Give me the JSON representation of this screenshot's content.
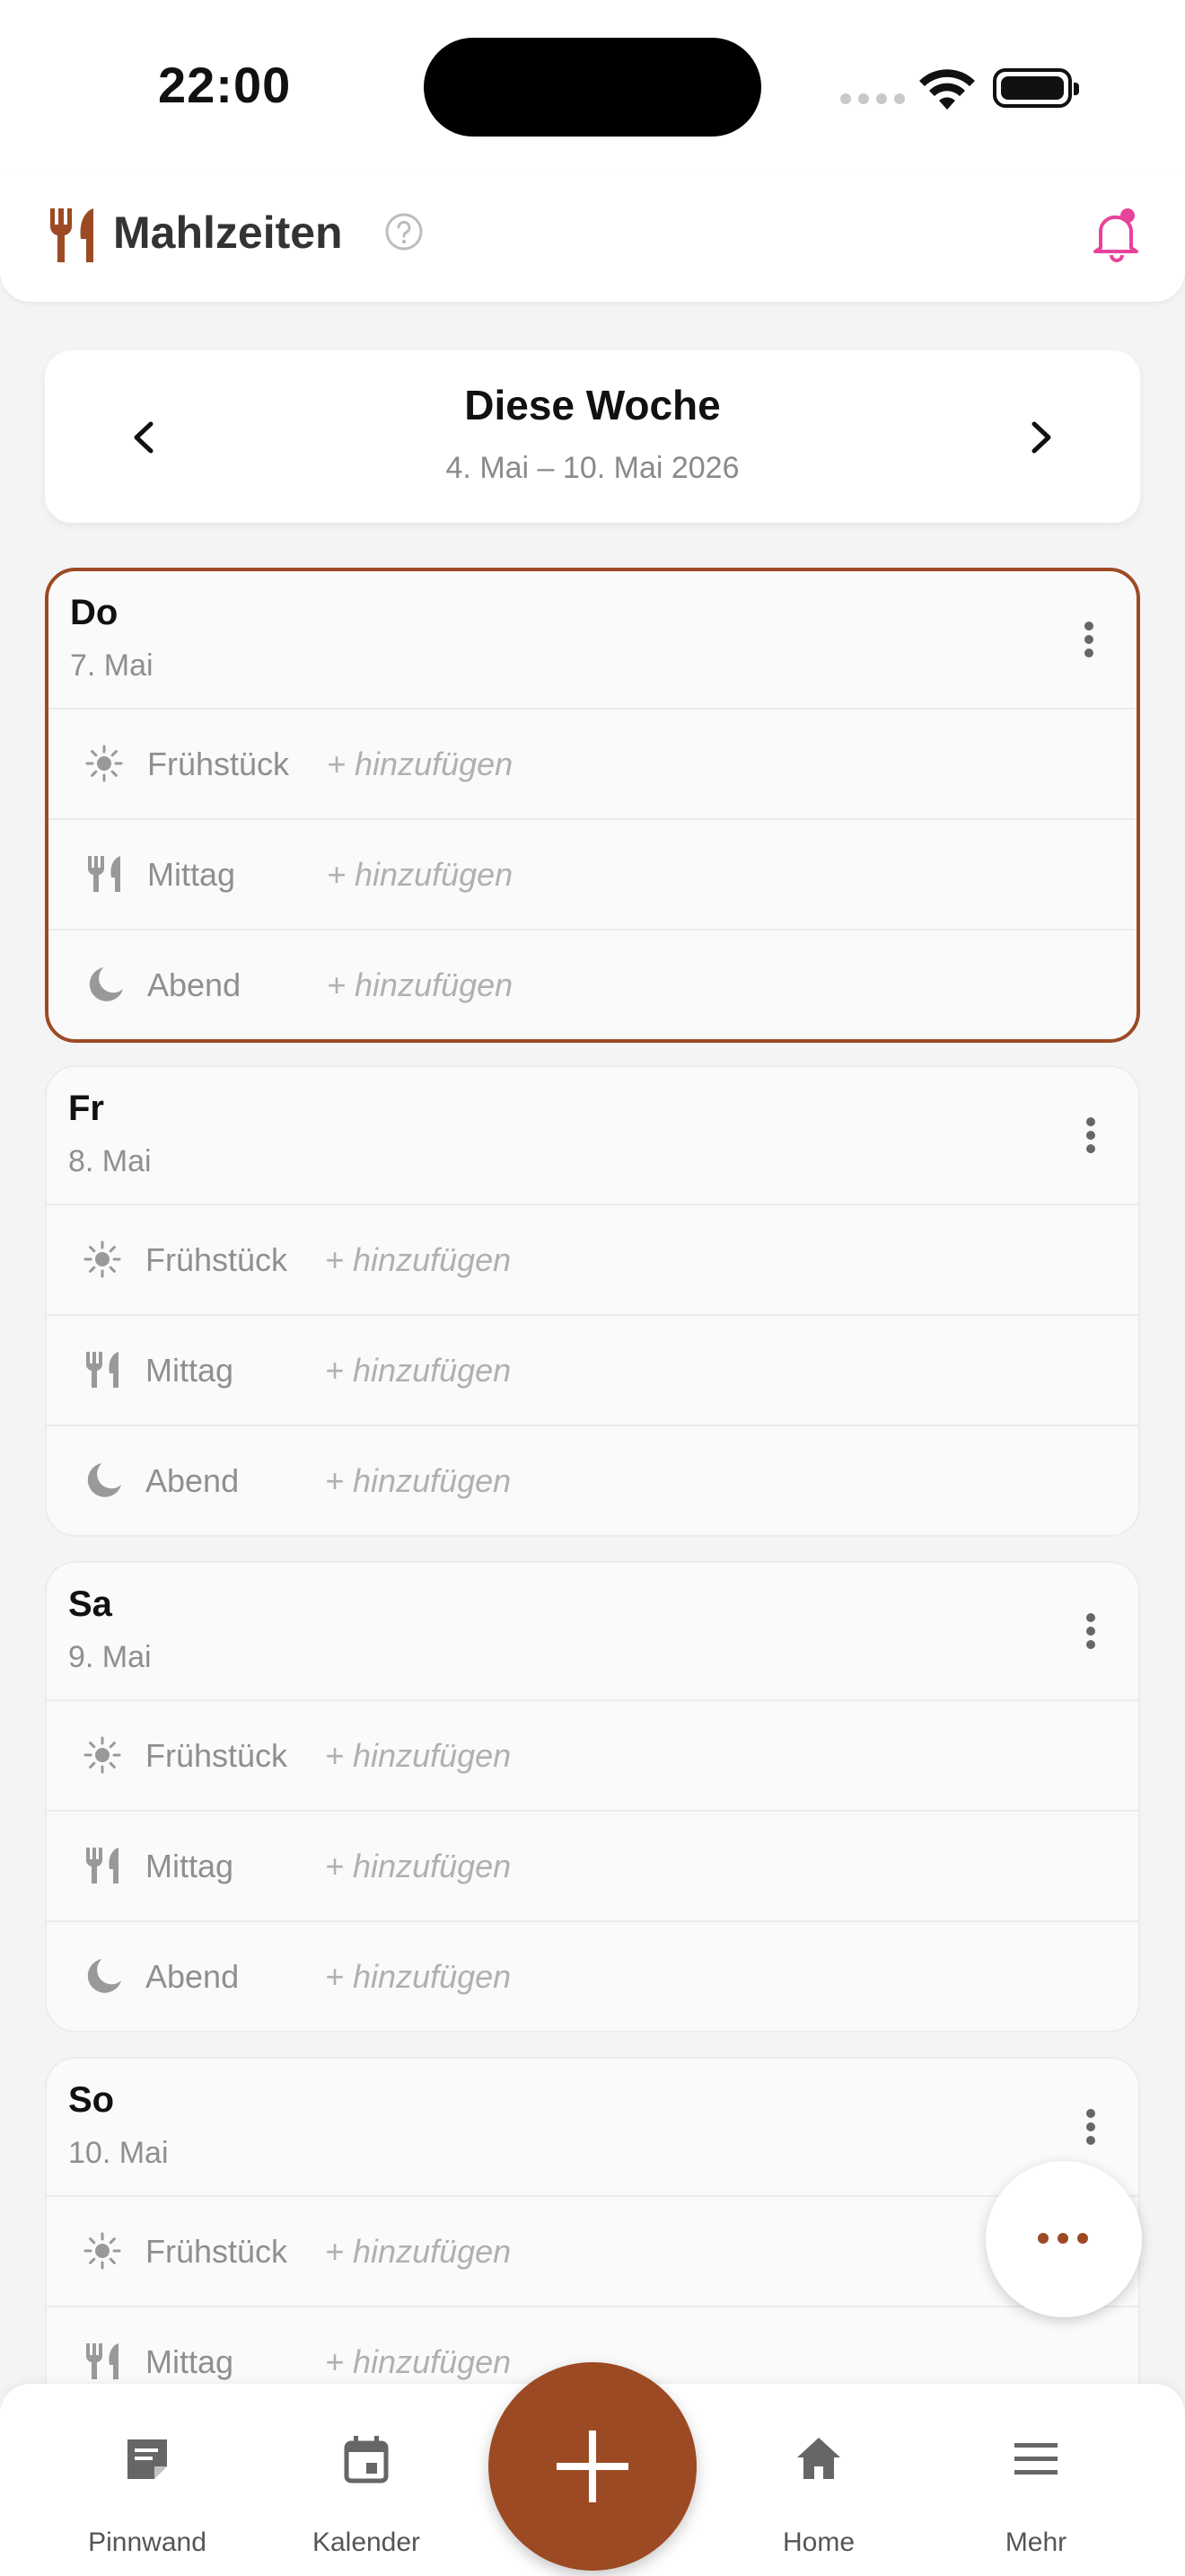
{
  "status_bar": {
    "time": "22:00"
  },
  "app_bar": {
    "title": "Mahlzeiten"
  },
  "week": {
    "title": "Diese Woche",
    "range": "4. Mai – 10. Mai 2026"
  },
  "days": [
    {
      "name": "Do",
      "date": "7. Mai",
      "today": true,
      "meals": [
        {
          "label": "Frühstück",
          "add": "+ hinzufügen",
          "icon": "sun-icon"
        },
        {
          "label": "Mittag",
          "add": "+ hinzufügen",
          "icon": "cutlery-icon"
        },
        {
          "label": "Abend",
          "add": "+ hinzufügen",
          "icon": "moon-icon"
        }
      ]
    },
    {
      "name": "Fr",
      "date": "8. Mai",
      "meals": [
        {
          "label": "Frühstück",
          "add": "+ hinzufügen",
          "icon": "sun-icon"
        },
        {
          "label": "Mittag",
          "add": "+ hinzufügen",
          "icon": "cutlery-icon"
        },
        {
          "label": "Abend",
          "add": "+ hinzufügen",
          "icon": "moon-icon"
        }
      ]
    },
    {
      "name": "Sa",
      "date": "9. Mai",
      "meals": [
        {
          "label": "Frühstück",
          "add": "+ hinzufügen",
          "icon": "sun-icon"
        },
        {
          "label": "Mittag",
          "add": "+ hinzufügen",
          "icon": "cutlery-icon"
        },
        {
          "label": "Abend",
          "add": "+ hinzufügen",
          "icon": "moon-icon"
        }
      ]
    },
    {
      "name": "So",
      "date": "10. Mai",
      "meals": [
        {
          "label": "Frühstück",
          "add": "+ hinzufügen",
          "icon": "sun-icon"
        },
        {
          "label": "Mittag",
          "add": "+ hinzufügen",
          "icon": "cutlery-icon"
        }
      ]
    }
  ],
  "nav": [
    {
      "label": "Pinnwand",
      "icon": "note-icon"
    },
    {
      "label": "Kalender",
      "icon": "calendar-icon"
    },
    {
      "label": "Home",
      "icon": "home-icon"
    },
    {
      "label": "Mehr",
      "icon": "menu-icon"
    }
  ],
  "colors": {
    "accent": "#9c4a24",
    "bell": "#e8439a",
    "background": "#f4f4f5"
  }
}
